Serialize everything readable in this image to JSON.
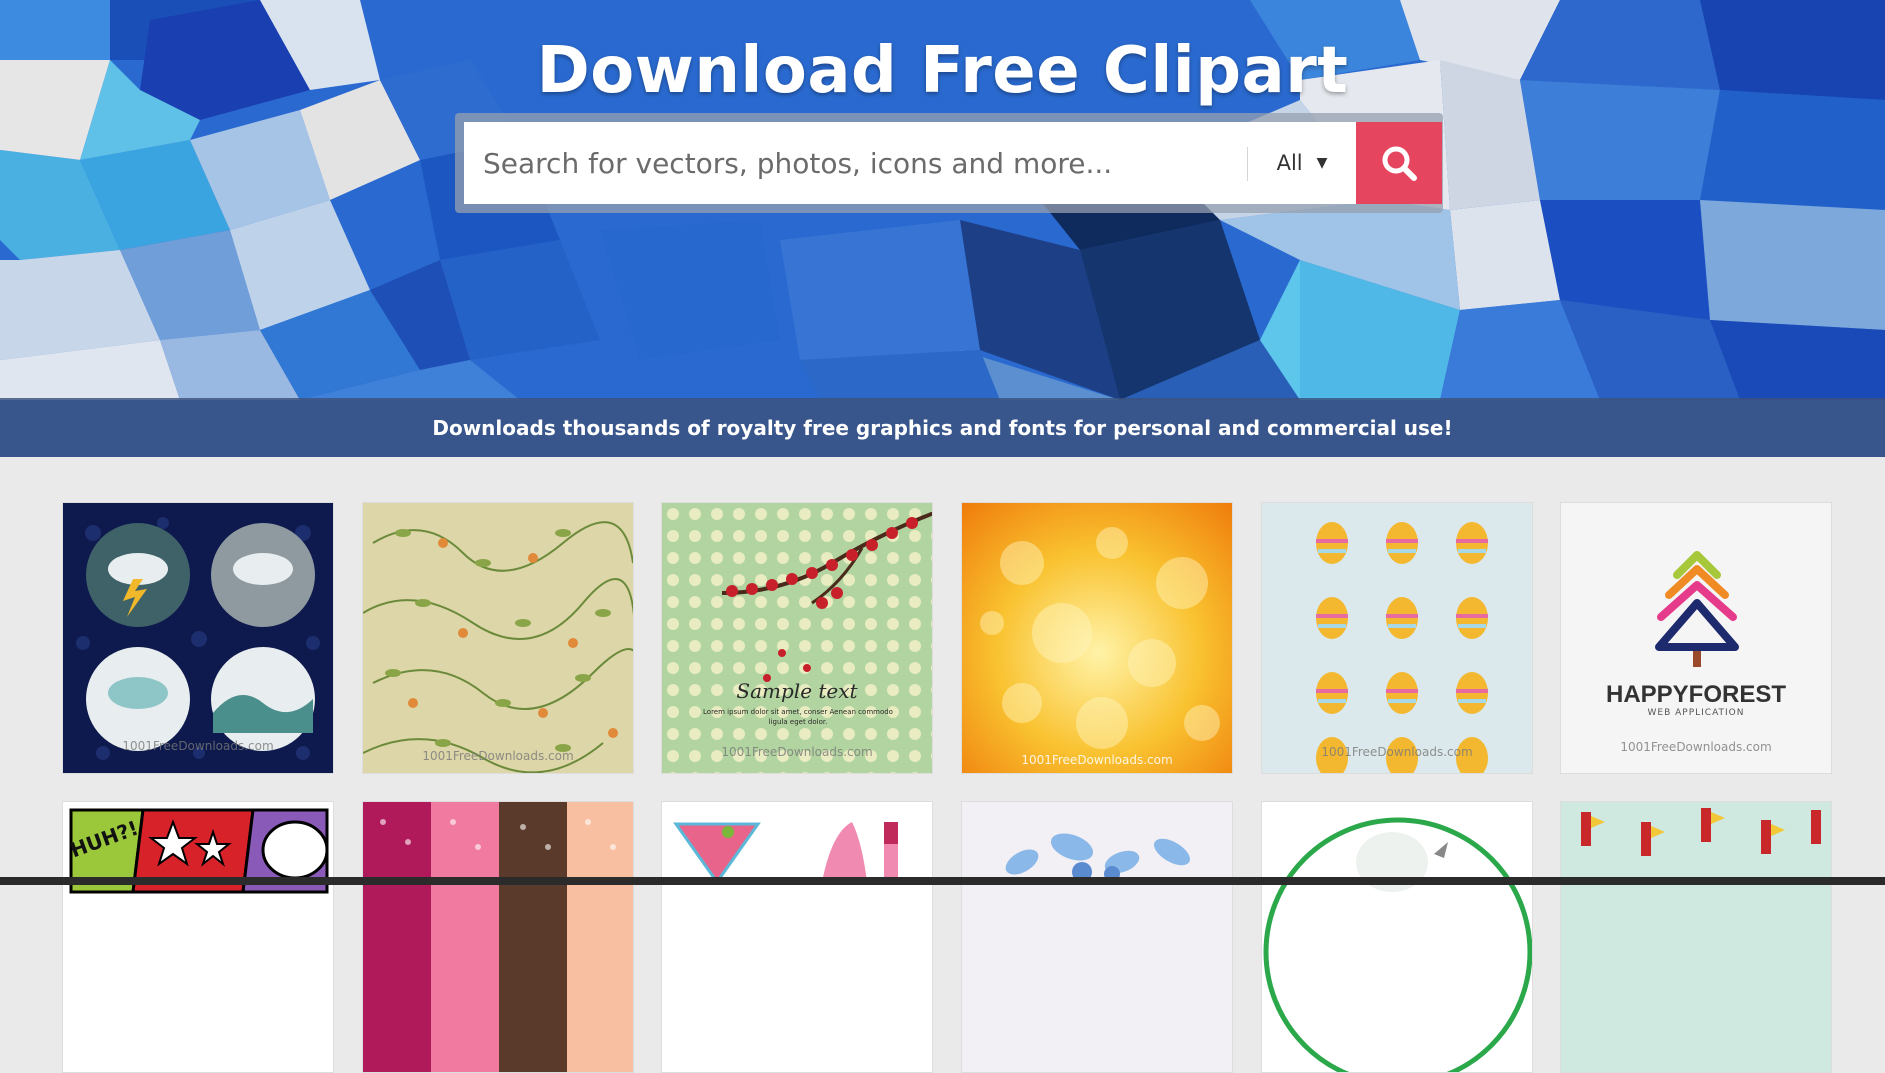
{
  "hero": {
    "title": "Download Free Clipart",
    "tagline": "Downloads thousands of royalty free graphics and fonts for personal and commercial use!"
  },
  "search": {
    "placeholder": "Search for vectors, photos, icons and more...",
    "filter_value": "All",
    "button_icon": "search-icon"
  },
  "colors": {
    "search_button": "#e64560",
    "tagline_bar": "#3c527d"
  },
  "watermark": "1001FreeDownloads.com",
  "thumbnails": {
    "row1": [
      {
        "name": "weather-icons"
      },
      {
        "name": "vintage-floral-pattern"
      },
      {
        "name": "cherry-blossom-polka-dot",
        "text": "Sample text",
        "subtext": "Lorem ipsum dolor sit amet, conser Aenean commodo ligula eget dolor."
      },
      {
        "name": "golden-bokeh-background"
      },
      {
        "name": "easter-egg-pattern"
      },
      {
        "name": "happyforest-logo",
        "logo_text": "HAPPYFOREST",
        "logo_sub": "WEB APPLICATION"
      }
    ],
    "row2": [
      {
        "name": "comic-stickers",
        "text": "HUH?!"
      },
      {
        "name": "hearts-patterns"
      },
      {
        "name": "fashion-icons"
      },
      {
        "name": "blue-floral-ornament"
      },
      {
        "name": "green-circle-badge"
      },
      {
        "name": "christmas-pattern"
      }
    ]
  }
}
